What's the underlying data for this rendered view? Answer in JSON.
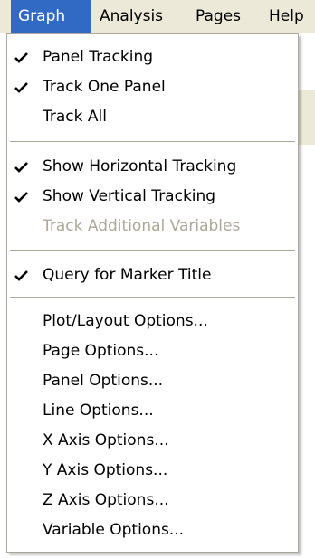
{
  "menubar": {
    "items": [
      {
        "label": "Graph",
        "active": true
      },
      {
        "label": "Analysis",
        "active": false
      },
      {
        "label": "Pages",
        "active": false
      },
      {
        "label": "Help",
        "active": false
      }
    ]
  },
  "menu": {
    "items": [
      {
        "label": "Panel Tracking",
        "checked": true,
        "enabled": true
      },
      {
        "label": "Track One Panel",
        "checked": true,
        "enabled": true
      },
      {
        "label": "Track All",
        "checked": false,
        "enabled": true
      },
      {
        "label": "Show Horizontal Tracking",
        "checked": true,
        "enabled": true
      },
      {
        "label": "Show Vertical Tracking",
        "checked": true,
        "enabled": true
      },
      {
        "label": "Track Additional Variables",
        "checked": false,
        "enabled": false
      },
      {
        "label": "Query for Marker Title",
        "checked": true,
        "enabled": true
      },
      {
        "label": "Plot/Layout Options...",
        "checked": false,
        "enabled": true
      },
      {
        "label": "Page Options...",
        "checked": false,
        "enabled": true
      },
      {
        "label": "Panel Options...",
        "checked": false,
        "enabled": true
      },
      {
        "label": "Line Options...",
        "checked": false,
        "enabled": true
      },
      {
        "label": "X Axis Options...",
        "checked": false,
        "enabled": true
      },
      {
        "label": "Y Axis Options...",
        "checked": false,
        "enabled": true
      },
      {
        "label": "Z Axis Options...",
        "checked": false,
        "enabled": true
      },
      {
        "label": "Variable Options...",
        "checked": false,
        "enabled": true
      }
    ]
  },
  "icons": {
    "check": "checkmark-icon"
  },
  "colors": {
    "highlight": "#316ac5",
    "menubar_bg": "#ece9d8",
    "disabled_text": "#aca899",
    "separator": "#aca899"
  }
}
